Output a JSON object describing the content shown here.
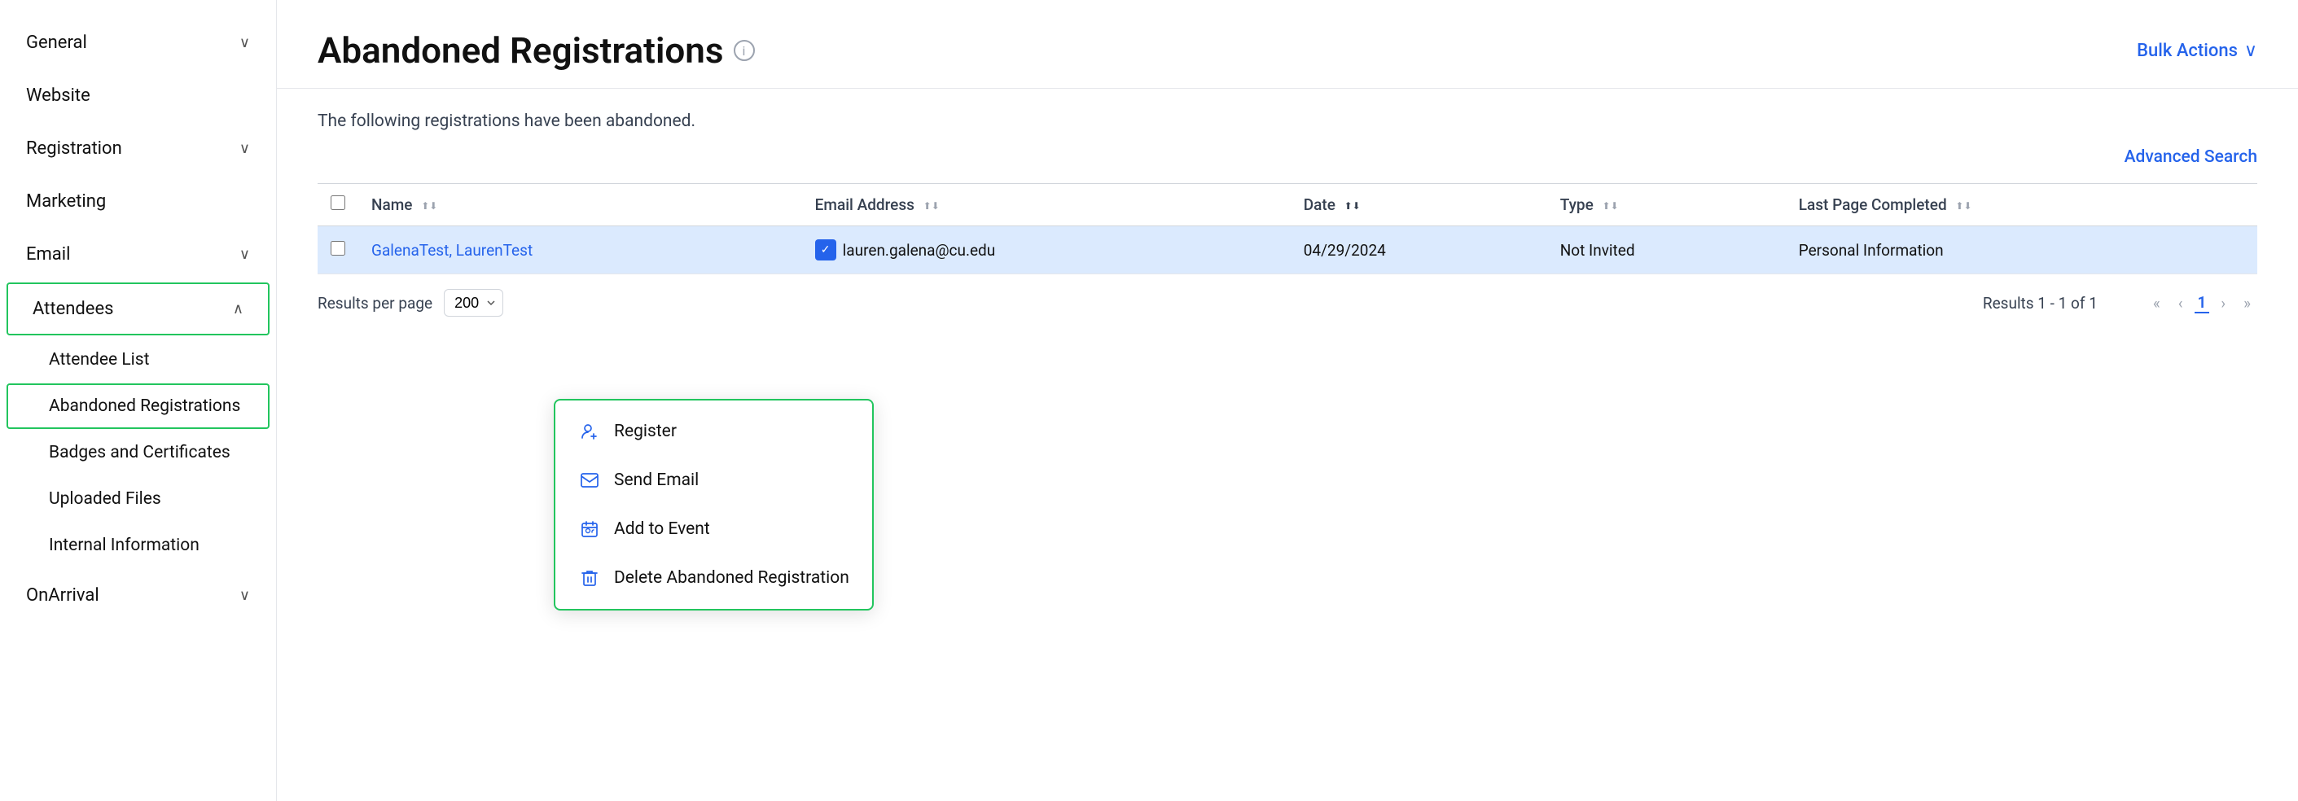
{
  "sidebar": {
    "items": [
      {
        "label": "General",
        "hasChevron": true,
        "expanded": false,
        "id": "general"
      },
      {
        "label": "Website",
        "hasChevron": false,
        "expanded": false,
        "id": "website"
      },
      {
        "label": "Registration",
        "hasChevron": true,
        "expanded": false,
        "id": "registration"
      },
      {
        "label": "Marketing",
        "hasChevron": false,
        "expanded": false,
        "id": "marketing"
      },
      {
        "label": "Email",
        "hasChevron": true,
        "expanded": false,
        "id": "email"
      },
      {
        "label": "Attendees",
        "hasChevron": true,
        "expanded": true,
        "id": "attendees",
        "activeParent": true
      }
    ],
    "subItems": [
      {
        "label": "Attendee List",
        "id": "attendee-list",
        "active": false
      },
      {
        "label": "Abandoned Registrations",
        "id": "abandoned-registrations",
        "active": true
      },
      {
        "label": "Badges and Certificates",
        "id": "badges-certificates",
        "active": false
      },
      {
        "label": "Uploaded Files",
        "id": "uploaded-files",
        "active": false
      },
      {
        "label": "Internal Information",
        "id": "internal-information",
        "active": false
      }
    ],
    "bottomItems": [
      {
        "label": "OnArrival",
        "hasChevron": true,
        "id": "onarrival"
      }
    ]
  },
  "header": {
    "title": "Abandoned Registrations",
    "info_icon_label": "i",
    "bulk_actions_label": "Bulk Actions"
  },
  "main": {
    "subtitle": "The following registrations have been abandoned.",
    "advanced_search_label": "Advanced Search"
  },
  "table": {
    "columns": [
      {
        "label": "Name",
        "sortable": true,
        "id": "name"
      },
      {
        "label": "Email Address",
        "sortable": true,
        "id": "email"
      },
      {
        "label": "Date",
        "sortable": true,
        "active": true,
        "id": "date"
      },
      {
        "label": "Type",
        "sortable": true,
        "id": "type"
      },
      {
        "label": "Last Page Completed",
        "sortable": true,
        "id": "last-page"
      }
    ],
    "rows": [
      {
        "id": "row1",
        "checked": false,
        "name": "GalenaTest, LaurenTest",
        "email": "lauren.galena@cu.edu",
        "emailVerified": true,
        "date": "04/29/2024",
        "type": "Not Invited",
        "lastPage": "Personal Information",
        "highlighted": true
      }
    ]
  },
  "pagination": {
    "results_per_page_label": "Results per page",
    "per_page_value": "200",
    "results_info": "Results 1 - 1 of 1",
    "current_page": "1"
  },
  "context_menu": {
    "items": [
      {
        "label": "Register",
        "icon": "register",
        "id": "register"
      },
      {
        "label": "Send Email",
        "icon": "email",
        "id": "send-email"
      },
      {
        "label": "Add to Event",
        "icon": "event",
        "id": "add-to-event"
      },
      {
        "label": "Delete Abandoned Registration",
        "icon": "delete",
        "id": "delete"
      }
    ]
  }
}
